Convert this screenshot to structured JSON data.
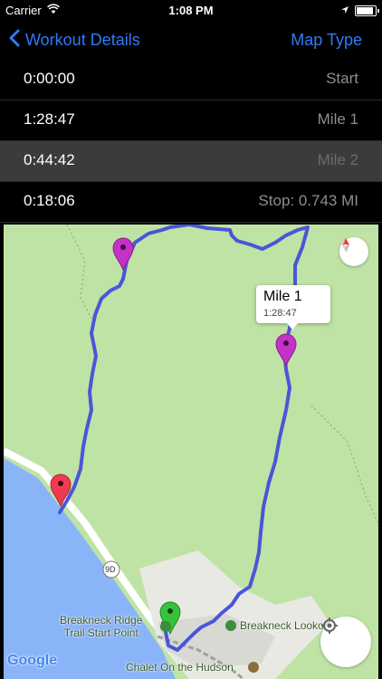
{
  "status_bar": {
    "carrier": "Carrier",
    "time": "1:08 PM"
  },
  "nav": {
    "back_label": "Workout Details",
    "right_label": "Map Type"
  },
  "splits": [
    {
      "time": "0:00:00",
      "label": "Start",
      "selected": false
    },
    {
      "time": "1:28:47",
      "label": "Mile 1",
      "selected": false
    },
    {
      "time": "0:44:42",
      "label": "Mile 2",
      "selected": true
    },
    {
      "time": "0:18:06",
      "label": "Stop: 0.743 MI",
      "selected": false
    }
  ],
  "map": {
    "callout": {
      "title": "Mile 1",
      "subtitle": "1:28:47"
    },
    "labels": {
      "trail_start": "Breakneck Ridge\nTrail Start Point",
      "lookout": "Breakneck Looko",
      "chalet": "Chalet On the Hudson",
      "road": "9D"
    },
    "attribution": "Google",
    "colors": {
      "route": "#4a56d8",
      "water": "#8ab4f8",
      "land": "#bfe3a5",
      "start_pin": "#35c33d",
      "stop_pin": "#ef3b52",
      "mile_pin": "#c532c7"
    }
  }
}
